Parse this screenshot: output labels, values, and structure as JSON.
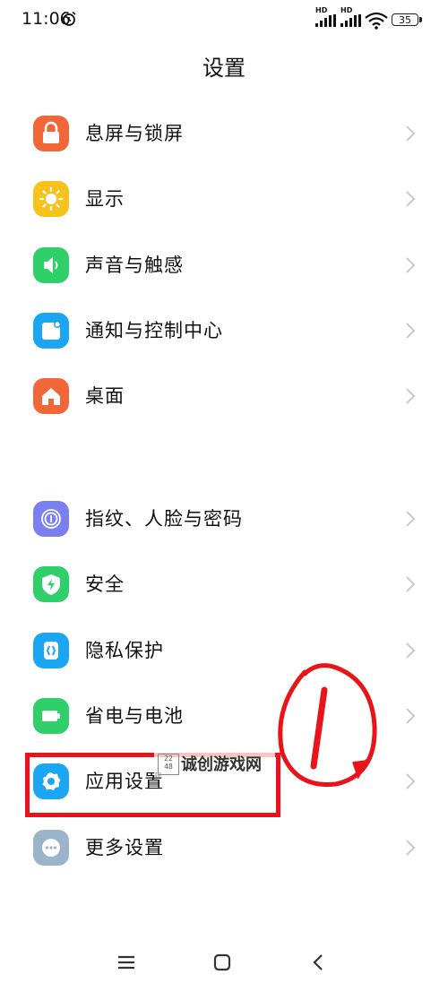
{
  "status_bar": {
    "time": "11:06",
    "signal_1_label": "HD",
    "signal_2_label": "HD",
    "battery_level": "35"
  },
  "page_title": "设置",
  "groups": [
    {
      "items": [
        {
          "label": "息屏与锁屏",
          "icon": "lock-icon",
          "color": "#f2673a"
        },
        {
          "label": "显示",
          "icon": "sun-icon",
          "color": "#f7c21b"
        },
        {
          "label": "声音与触感",
          "icon": "speaker-icon",
          "color": "#2fcf6a"
        },
        {
          "label": "通知与控制中心",
          "icon": "notification-icon",
          "color": "#1aa6f2"
        },
        {
          "label": "桌面",
          "icon": "home-icon",
          "color": "#f2673a"
        }
      ]
    },
    {
      "items": [
        {
          "label": "指纹、人脸与密码",
          "icon": "fingerprint-icon",
          "color": "#7b7ff0"
        },
        {
          "label": "安全",
          "icon": "shield-icon",
          "color": "#2fcf6a"
        },
        {
          "label": "隐私保护",
          "icon": "privacy-icon",
          "color": "#1aa6f2"
        },
        {
          "label": "省电与电池",
          "icon": "battery-icon",
          "color": "#2fcf6a"
        },
        {
          "label": "应用设置",
          "icon": "gear-icon",
          "color": "#1aa6f2"
        },
        {
          "label": "更多设置",
          "icon": "more-icon",
          "color": "#9bb4cc"
        }
      ]
    }
  ],
  "watermark": {
    "text": "诚创游戏网",
    "logo_text": "22 48"
  },
  "annotation": {
    "mark_text": "1",
    "color": "#e8141a"
  },
  "nav": {
    "menu_icon": "menu-icon",
    "home_icon": "home-square-icon",
    "back_icon": "back-icon"
  }
}
